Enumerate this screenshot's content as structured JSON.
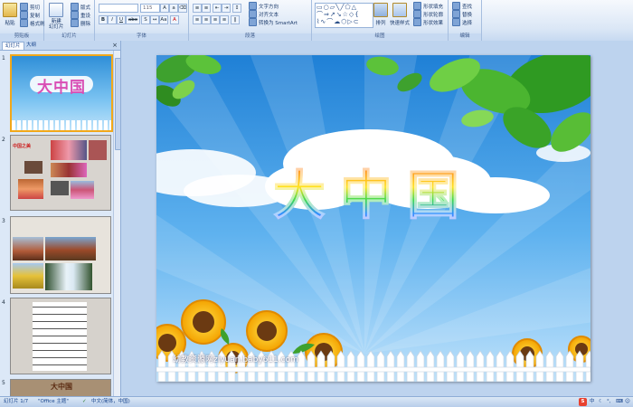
{
  "ribbon": {
    "clipboard": {
      "paste": "粘贴",
      "cut": "剪切",
      "copy": "复制",
      "format_painter": "格式刷",
      "label": "剪贴板"
    },
    "slides": {
      "new_slide": "新建\n幻灯片",
      "layout": "版式",
      "reset": "重设",
      "delete": "删除",
      "label": "幻灯片"
    },
    "font": {
      "font_name": "",
      "font_size": "115",
      "bold": "B",
      "italic": "I",
      "underline": "U",
      "shadow": "S",
      "strike": "abe",
      "label": "字体"
    },
    "paragraph": {
      "text_direction": "文字方向",
      "align_text": "对齐文本",
      "convert_smartart": "转换为 SmartArt",
      "label": "段落"
    },
    "drawing": {
      "arrange": "排列",
      "quick_styles": "快速样式",
      "shape_fill": "形状填充",
      "shape_outline": "形状轮廓",
      "shape_effects": "形状效果",
      "label": "绘图"
    },
    "editing": {
      "find": "查找",
      "replace": "替换",
      "select": "选择",
      "label": "编辑"
    }
  },
  "left_panel": {
    "tabs": [
      "幻灯片",
      "大纲"
    ],
    "slide_numbers": [
      "1",
      "2",
      "3",
      "4",
      "5"
    ],
    "thumb2_caption": "中国之美",
    "thumb5_title": "大中国"
  },
  "slide": {
    "title": "大中国",
    "watermark": "幼教资源网ziyuan.baby611.com",
    "watermark_sub": "PPT课件、FLASH动画、教案随便下载"
  },
  "statusbar": {
    "slide_pos": "幻灯片 1/7",
    "theme": "\"Office 主题\"",
    "language": "中文(简体，中国)"
  },
  "colors": {
    "ribbon": "#dbe7f6",
    "panel": "#bdd3ee",
    "selected_border": "#f2a81a"
  }
}
